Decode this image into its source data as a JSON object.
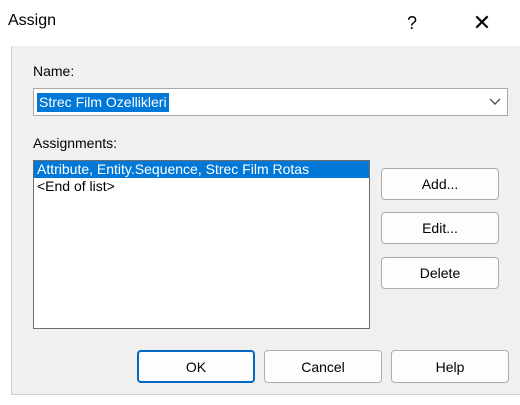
{
  "window": {
    "title": "Assign",
    "help_glyph": "?",
    "close_glyph": "✕"
  },
  "name_field": {
    "label": "Name:",
    "value": "Strec Film Ozellikleri"
  },
  "assignments": {
    "label": "Assignments:",
    "items": [
      {
        "text": "Attribute, Entity.Sequence, Strec Film Rotas",
        "selected": true
      },
      {
        "text": "<End of list>",
        "selected": false
      }
    ]
  },
  "side_buttons": {
    "add": "Add...",
    "edit": "Edit...",
    "delete": "Delete"
  },
  "footer_buttons": {
    "ok": "OK",
    "cancel": "Cancel",
    "help": "Help"
  },
  "colors": {
    "selection": "#0078d7",
    "default_button_border": "#0067c0",
    "dialog_bg": "#f0f0f0"
  }
}
